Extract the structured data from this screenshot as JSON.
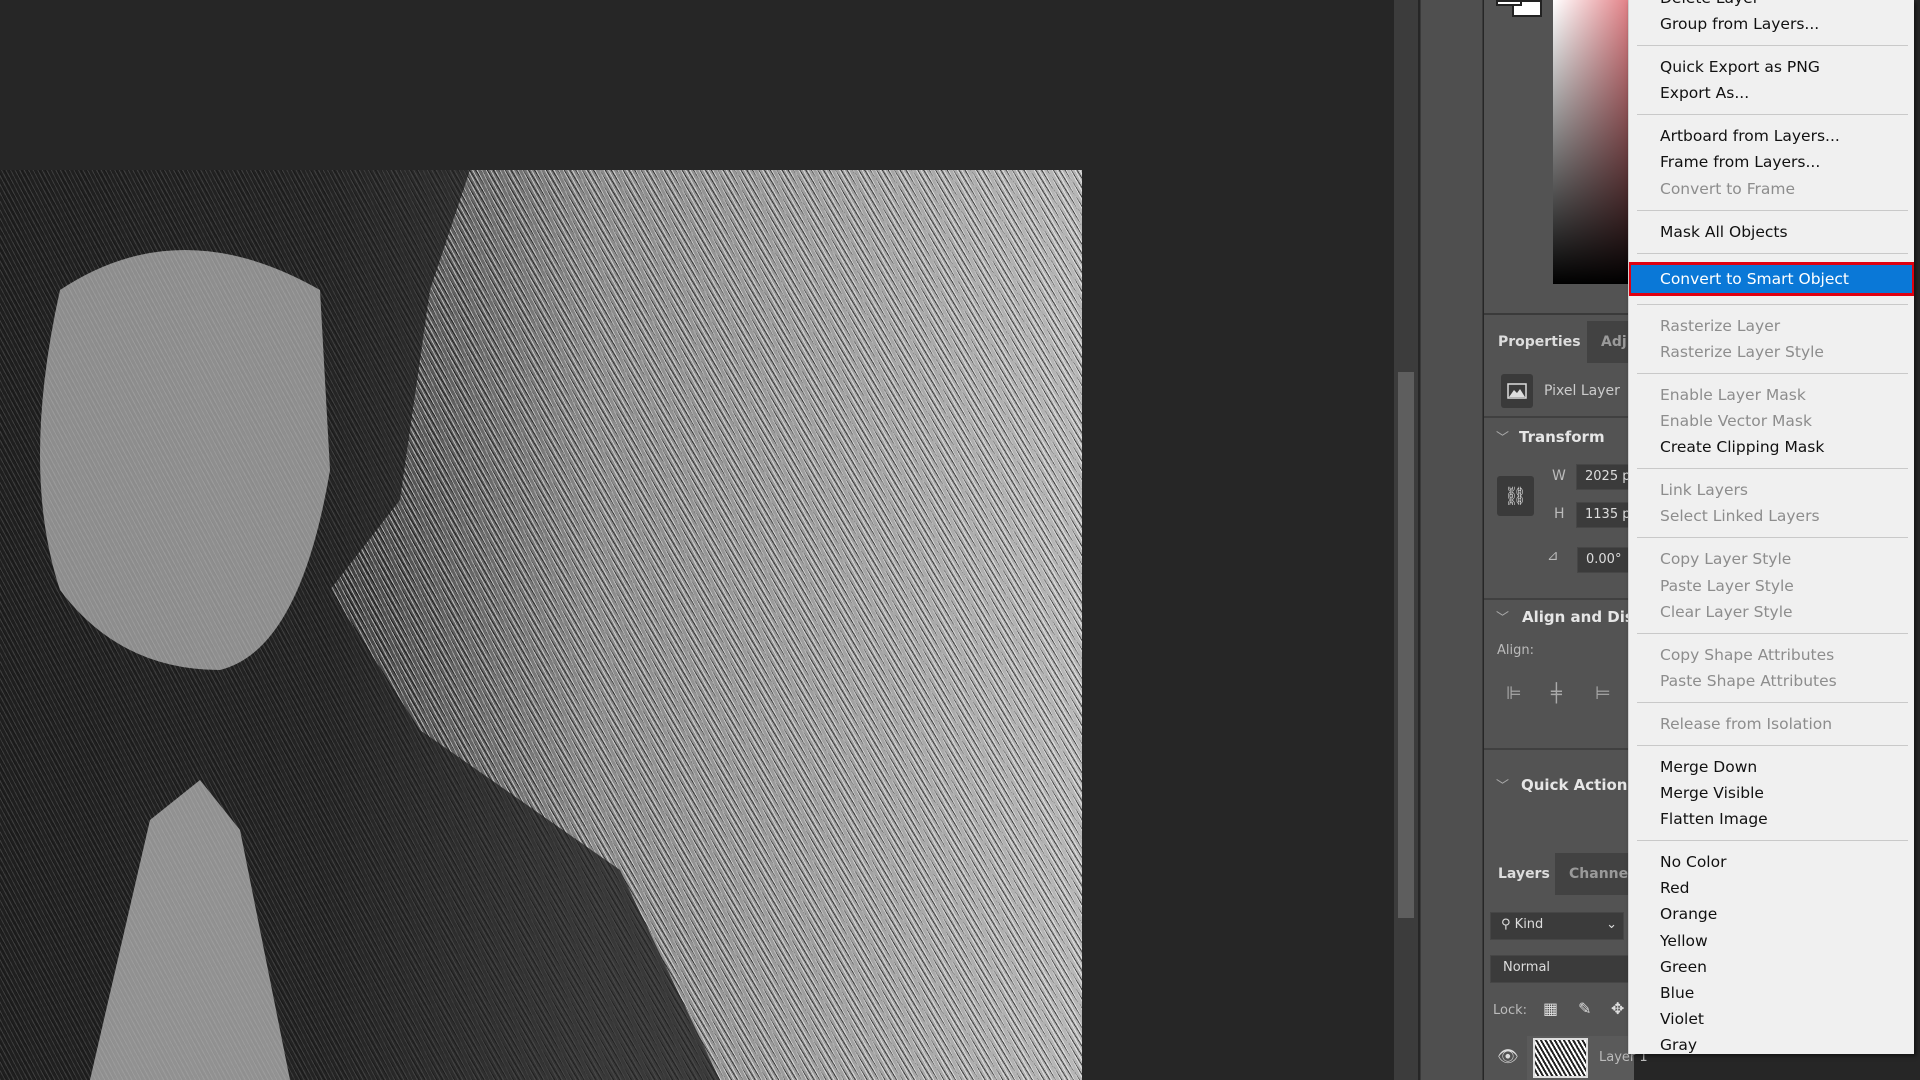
{
  "properties_panel": {
    "tabs": [
      "Properties",
      "Adj"
    ],
    "layer_type": "Pixel Layer",
    "transform": {
      "title": "Transform",
      "w_label": "W",
      "w_value": "2025 p",
      "h_label": "H",
      "h_value": "1135 p",
      "angle_value": "0.00°"
    },
    "align": {
      "title": "Align and Dist",
      "align_label": "Align:"
    },
    "quick_actions": {
      "title": "Quick Actions"
    }
  },
  "layers_panel": {
    "tabs": [
      "Layers",
      "Channe"
    ],
    "filter": "Kind",
    "blend_mode": "Normal",
    "lock_label": "Lock:",
    "layer_name": "Layer 1"
  },
  "context_menu": {
    "highlight_color": "#0a78d7",
    "highlight_outline": "#e00010",
    "groups": [
      [
        {
          "label": "Delete Layer",
          "enabled": true
        },
        {
          "label": "Group from Layers...",
          "enabled": true
        }
      ],
      [
        {
          "label": "Quick Export as PNG",
          "enabled": true
        },
        {
          "label": "Export As...",
          "enabled": true
        }
      ],
      [
        {
          "label": "Artboard from Layers...",
          "enabled": true
        },
        {
          "label": "Frame from Layers...",
          "enabled": true
        },
        {
          "label": "Convert to Frame",
          "enabled": false
        }
      ],
      [
        {
          "label": "Mask All Objects",
          "enabled": true
        }
      ],
      [
        {
          "label": "Convert to Smart Object",
          "enabled": true,
          "highlighted": true
        }
      ],
      [
        {
          "label": "Rasterize Layer",
          "enabled": false
        },
        {
          "label": "Rasterize Layer Style",
          "enabled": false
        }
      ],
      [
        {
          "label": "Enable Layer Mask",
          "enabled": false
        },
        {
          "label": "Enable Vector Mask",
          "enabled": false
        },
        {
          "label": "Create Clipping Mask",
          "enabled": true
        }
      ],
      [
        {
          "label": "Link Layers",
          "enabled": false
        },
        {
          "label": "Select Linked Layers",
          "enabled": false
        }
      ],
      [
        {
          "label": "Copy Layer Style",
          "enabled": false
        },
        {
          "label": "Paste Layer Style",
          "enabled": false
        },
        {
          "label": "Clear Layer Style",
          "enabled": false
        }
      ],
      [
        {
          "label": "Copy Shape Attributes",
          "enabled": false
        },
        {
          "label": "Paste Shape Attributes",
          "enabled": false
        }
      ],
      [
        {
          "label": "Release from Isolation",
          "enabled": false
        }
      ],
      [
        {
          "label": "Merge Down",
          "enabled": true
        },
        {
          "label": "Merge Visible",
          "enabled": true
        },
        {
          "label": "Flatten Image",
          "enabled": true
        }
      ],
      [
        {
          "label": "No Color",
          "enabled": true
        },
        {
          "label": "Red",
          "enabled": true
        },
        {
          "label": "Orange",
          "enabled": true
        },
        {
          "label": "Yellow",
          "enabled": true
        },
        {
          "label": "Green",
          "enabled": true
        },
        {
          "label": "Blue",
          "enabled": true
        },
        {
          "label": "Violet",
          "enabled": true
        },
        {
          "label": "Gray",
          "enabled": true
        }
      ]
    ]
  }
}
